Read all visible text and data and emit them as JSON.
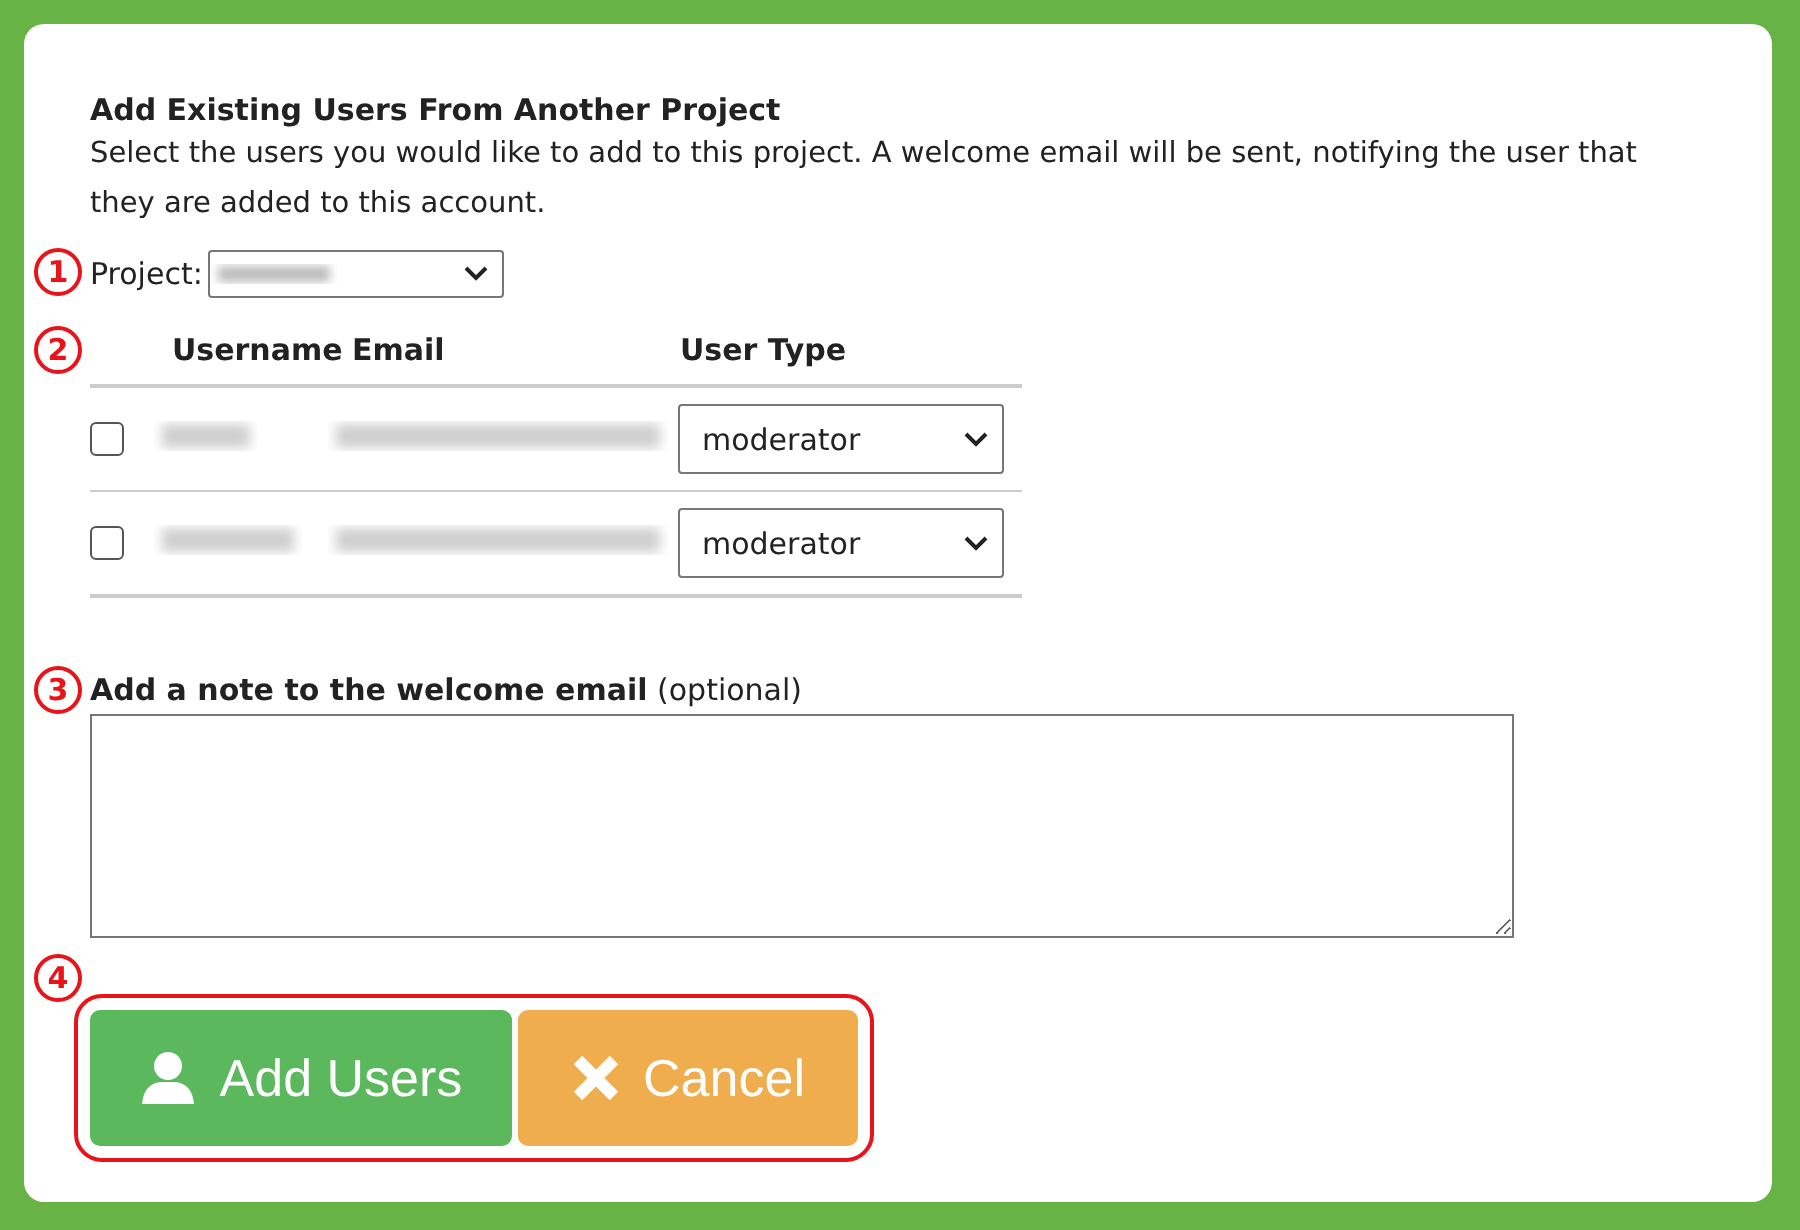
{
  "heading": "Add Existing Users From Another Project",
  "description": "Select the users you would like to add to this project. A welcome email will be sent, notifying the user that they are added to this account.",
  "project": {
    "callout": "1",
    "label": "Project:"
  },
  "table": {
    "callout": "2",
    "columns": [
      "Username",
      "Email",
      "User Type"
    ],
    "rows": [
      {
        "checked": false,
        "user_type": "moderator"
      },
      {
        "checked": false,
        "user_type": "moderator"
      }
    ]
  },
  "note": {
    "callout": "3",
    "label": "**Add a note to the welcome email** (optional)"
  },
  "actions": {
    "callout": "4",
    "buttons": [
      {
        "label": "Add Users",
        "kind": "add"
      },
      {
        "label": "Cancel",
        "kind": "cancel"
      }
    ]
  }
}
